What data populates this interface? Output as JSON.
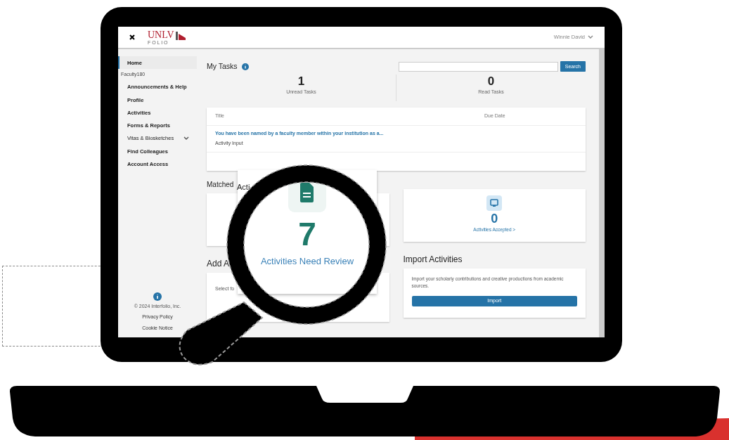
{
  "header": {
    "logo": "UNLV",
    "logo_sub": "F O L I O",
    "user": "Winnie David"
  },
  "sidebar": {
    "items": [
      {
        "label": "Home",
        "kind": "link",
        "selected": true
      },
      {
        "label": "Faculty180",
        "kind": "section",
        "selected": false
      },
      {
        "label": "Announcements & Help",
        "kind": "link",
        "selected": false
      },
      {
        "label": "Profile",
        "kind": "link",
        "selected": false
      },
      {
        "label": "Activities",
        "kind": "link",
        "selected": false
      },
      {
        "label": "Forms & Reports",
        "kind": "link",
        "selected": false
      },
      {
        "label": "Vitas & Biosketches",
        "kind": "expandable",
        "selected": false
      },
      {
        "label": "Find Colleagues",
        "kind": "link",
        "selected": false
      },
      {
        "label": "Account Access",
        "kind": "link",
        "selected": false
      }
    ],
    "footer": {
      "copyright": "© 2024 Interfolio, Inc.",
      "links": [
        "Privacy Policy",
        "Cookie Notice"
      ]
    }
  },
  "tasks": {
    "title": "My Tasks",
    "search_button": "Search",
    "stats": [
      {
        "value": "1",
        "label": "Unread Tasks"
      },
      {
        "value": "0",
        "label": "Read Tasks"
      }
    ],
    "columns": [
      "Title",
      "Due Date"
    ],
    "rows": [
      {
        "title": "You have been named by a faculty member within your institution as a...",
        "subtitle": "Activity Input"
      }
    ]
  },
  "matched": {
    "heading": "Matched",
    "accepted": {
      "value": "0",
      "label": "Activities Accepted >"
    }
  },
  "add": {
    "heading": "Add A",
    "text": "Select fo"
  },
  "import": {
    "heading": "Import Activities",
    "text": "Import your scholarly contributions and creative productions from academic sources.",
    "button": "Import"
  },
  "magnifier": {
    "heading": "Acti",
    "value": "7",
    "label": "Activities Need Review"
  }
}
